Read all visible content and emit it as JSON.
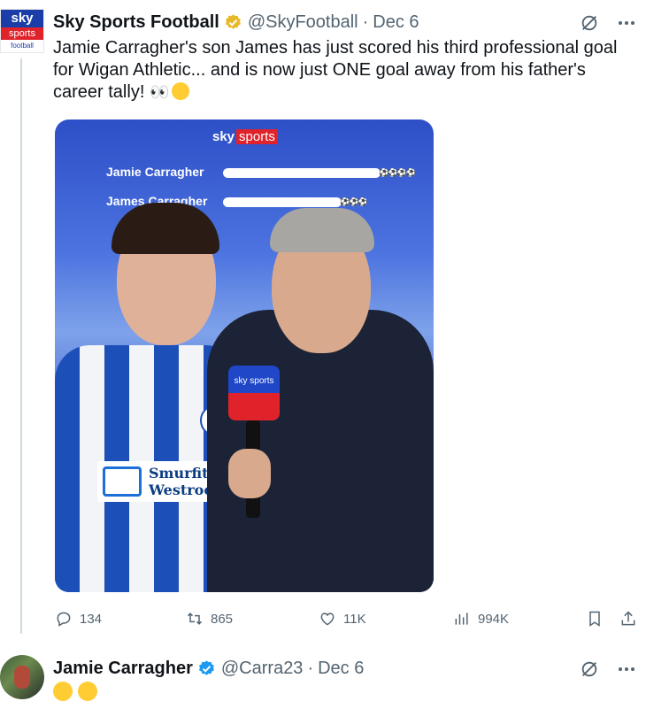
{
  "tweet1": {
    "avatar": {
      "line1": "sky",
      "line2": "sports",
      "line3": "football"
    },
    "name": "Sky Sports Football",
    "handle": "@SkyFootball",
    "separator": "·",
    "date": "Dec 6",
    "text": "Jamie Carragher's son James has just scored his third professional goal for Wigan Athletic... and is now just ONE goal away from his father's career tally!",
    "media": {
      "logo_sky": "sky",
      "logo_sports": "sports",
      "bars": [
        {
          "label": "Jamie Carragher",
          "goals": 4
        },
        {
          "label": "James Carragher",
          "goals": 3
        }
      ],
      "mic_text": "sky sports",
      "sponsor": "Smurfit Westrock"
    },
    "actions": {
      "replies": "134",
      "reposts": "865",
      "likes": "11K",
      "views": "994K"
    }
  },
  "tweet2": {
    "name": "Jamie Carragher",
    "handle": "@Carra23",
    "separator": "·",
    "date": "Dec 6"
  },
  "colors": {
    "verified_gold": "#e8b829",
    "verified_blue": "#1d9bf0",
    "muted": "#536471",
    "sky_blue": "#1a3da8",
    "sky_red": "#e0232b"
  }
}
